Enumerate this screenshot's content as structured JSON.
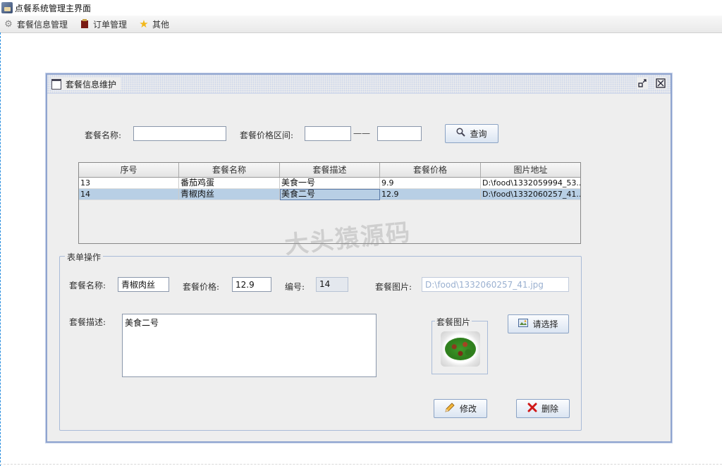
{
  "window": {
    "title": "点餐系统管理主界面"
  },
  "menu": [
    {
      "label": "套餐信息管理",
      "icon": "gear-icon"
    },
    {
      "label": "订单管理",
      "icon": "order-icon"
    },
    {
      "label": "其他",
      "icon": "star-icon"
    }
  ],
  "frame": {
    "title": "套餐信息维护"
  },
  "search": {
    "name_label": "套餐名称:",
    "name_value": "",
    "price_label": "套餐价格区间:",
    "price_min": "",
    "dash": "——",
    "price_max": "",
    "button_label": "查询"
  },
  "table": {
    "columns": [
      "序号",
      "套餐名称",
      "套餐描述",
      "套餐价格",
      "图片地址"
    ],
    "rows": [
      [
        "13",
        "番茄鸡蛋",
        "美食一号",
        "9.9",
        "D:\\food\\1332059994_53..."
      ],
      [
        "14",
        "青椒肉丝",
        "美食二号",
        "12.9",
        "D:\\food\\1332060257_41..."
      ]
    ],
    "selected_row": 1
  },
  "watermark": "大头猿源码",
  "form": {
    "group_title": "表单操作",
    "name_label": "套餐名称:",
    "name_value": "青椒肉丝",
    "price_label": "套餐价格:",
    "price_value": "12.9",
    "id_label": "编号:",
    "id_value": "14",
    "image_label": "套餐图片:",
    "image_path": "D:\\food\\1332060257_41.jpg",
    "desc_label": "套餐描述:",
    "desc_value": "美食二号",
    "image_box_title": "套餐图片",
    "choose_button": "请选择",
    "modify_button": "修改",
    "delete_button": "删除"
  }
}
